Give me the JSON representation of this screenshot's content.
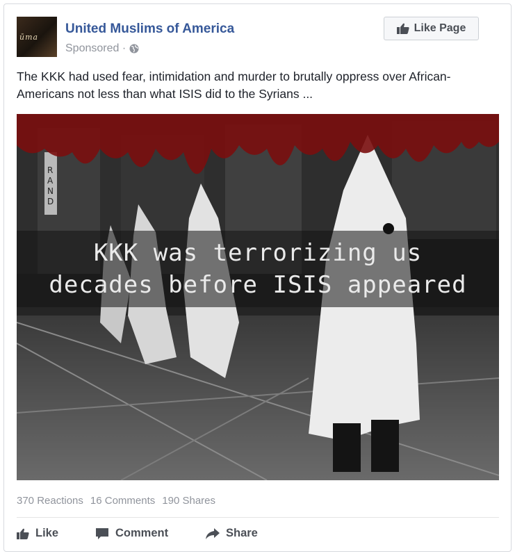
{
  "post": {
    "page_name": "United Muslims of America",
    "avatar_text": "ūma",
    "sponsored_label": "Sponsored · ",
    "like_page_label": "Like Page",
    "text": "The KKK had used fear, intimidation and murder to brutally oppress over African-Americans not less than what ISIS did to the Syrians ...",
    "image_caption_line1": "KKK was terrorizing us",
    "image_caption_line2": "decades before ISIS appeared",
    "image_sign_text": "RAND"
  },
  "stats": {
    "reactions": "370 Reactions",
    "comments": "16 Comments",
    "shares": "190 Shares"
  },
  "actions": {
    "like": "Like",
    "comment": "Comment",
    "share": "Share"
  },
  "colors": {
    "link_blue": "#365899",
    "muted_gray": "#90949c",
    "action_gray": "#4b4f56",
    "blood_red": "#7a0e0e"
  }
}
